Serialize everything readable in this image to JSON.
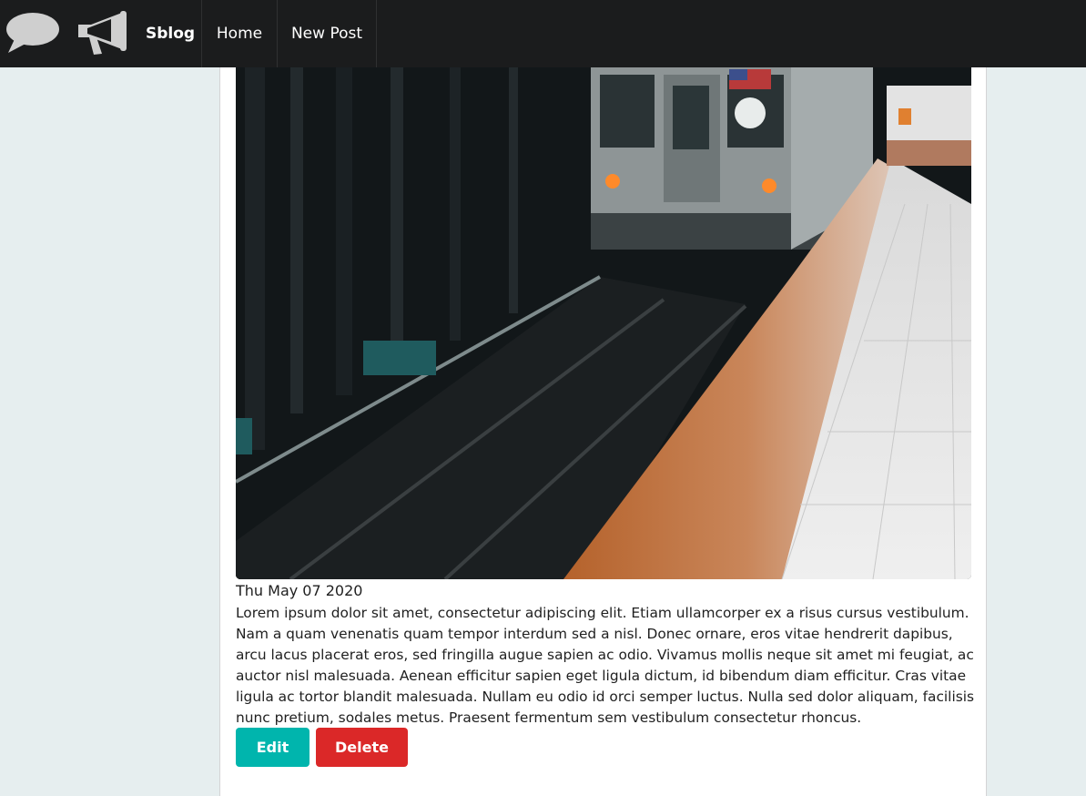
{
  "navbar": {
    "brand": "Sblog",
    "items": [
      {
        "label": "Home"
      },
      {
        "label": "New Post"
      }
    ],
    "icons": [
      "comment-icon",
      "bullhorn-icon"
    ]
  },
  "post": {
    "image": "subway-train-platform-photo",
    "date": "Thu May 07 2020",
    "body": "Lorem ipsum dolor sit amet, consectetur adipiscing elit. Etiam ullamcorper ex a risus cursus vestibulum. Nam a quam venenatis quam tempor interdum sed a nisl. Donec ornare, eros vitae hendrerit dapibus, arcu lacus placerat eros, sed fringilla augue sapien ac odio. Vivamus mollis neque sit amet mi feugiat, ac auctor nisl malesuada. Aenean efficitur sapien eget ligula dictum, id bibendum diam efficitur. Cras vitae ligula ac tortor blandit malesuada. Nullam eu odio id orci semper luctus. Nulla sed dolor aliquam, facilisis nunc pretium, sodales metus. Praesent fermentum sem vestibulum consectetur rhoncus.",
    "actions": {
      "edit_label": "Edit",
      "delete_label": "Delete"
    }
  },
  "colors": {
    "navbar_bg": "#1b1c1d",
    "page_bg": "#e6eeef",
    "edit": "#00b5ad",
    "delete": "#db2828"
  }
}
